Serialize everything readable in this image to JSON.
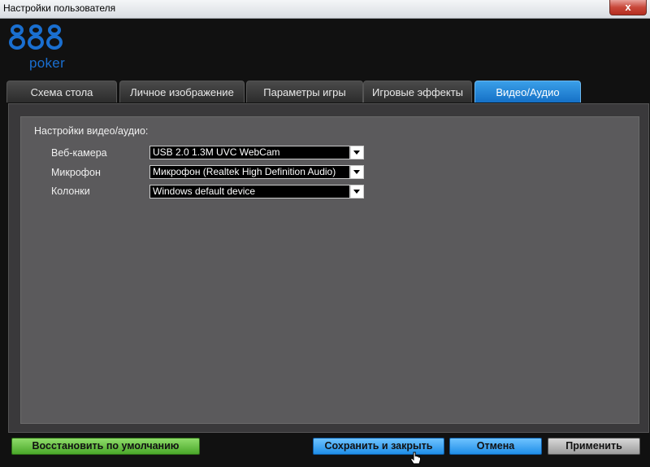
{
  "window": {
    "title": "Настройки пользователя",
    "close_label": "x"
  },
  "logo": {
    "digits": "888",
    "word": "poker",
    "brand_color": "#1a6fd0"
  },
  "tabs": [
    {
      "label": "Схема стола",
      "active": false
    },
    {
      "label": "Личное изображение",
      "active": false
    },
    {
      "label": "Параметры игры",
      "active": false
    },
    {
      "label": "Игровые эффекты",
      "active": false
    },
    {
      "label": "Видео/Аудио",
      "active": true
    }
  ],
  "av": {
    "section_title": "Настройки видео/аудио:",
    "rows": [
      {
        "label": "Веб-камера",
        "value": "USB 2.0 1.3M UVC WebCam"
      },
      {
        "label": "Микрофон",
        "value": "Микрофон (Realtek High Definition Audio)"
      },
      {
        "label": "Колонки",
        "value": "Windows default device"
      }
    ]
  },
  "buttons": {
    "restore": "Восстановить по умолчанию",
    "save_close": "Сохранить и закрыть",
    "cancel": "Отмена",
    "apply": "Применить"
  },
  "colors": {
    "accent_blue": "#1f8ee8",
    "restore_green": "#4aa82a"
  }
}
